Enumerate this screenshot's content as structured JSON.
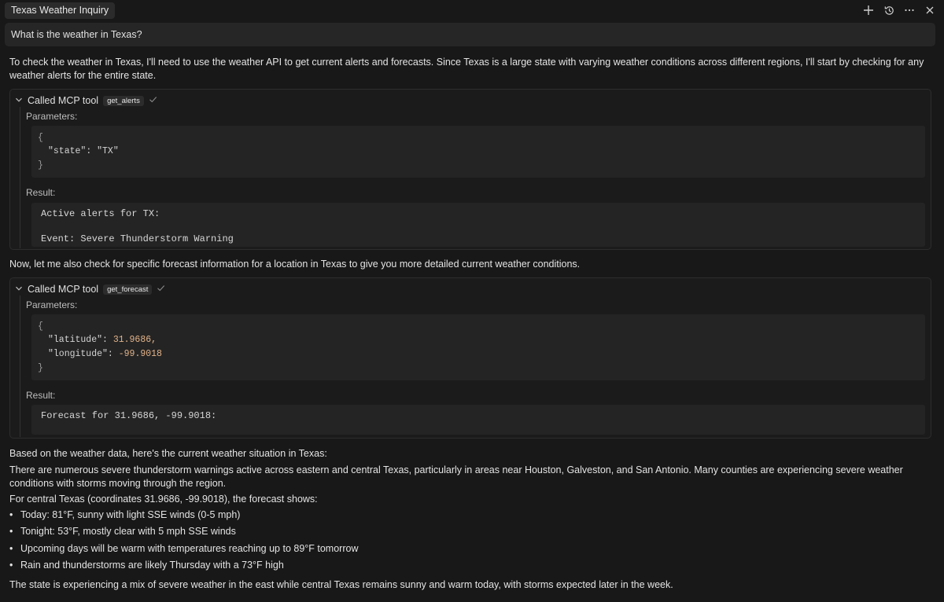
{
  "header": {
    "title": "Texas Weather Inquiry",
    "icons": {
      "new": "plus-icon",
      "history": "history-icon",
      "more": "more-icon",
      "close": "close-icon"
    }
  },
  "prompt": "What is the weather in Texas?",
  "intro": "To check the weather in Texas, I'll need to use the weather API to get current alerts and forecasts. Since Texas is a large state with varying weather conditions across different regions, I'll start by checking for any weather alerts for the entire state.",
  "tool_calls": [
    {
      "header": "Called MCP tool",
      "tool_name": "get_alerts",
      "parameters_label": "Parameters:",
      "params": {
        "open": "{",
        "line1_key": "\"state\"",
        "line1_sep": ": ",
        "line1_val": "\"TX\"",
        "close": "}"
      },
      "result_label": "Result:",
      "result_lines": [
        "Active alerts for TX:",
        "Event: Severe Thunderstorm Warning"
      ]
    },
    {
      "header": "Called MCP tool",
      "tool_name": "get_forecast",
      "parameters_label": "Parameters:",
      "params": {
        "open": "{",
        "line1_key": "\"latitude\"",
        "line1_sep": ": ",
        "line1_val": "31.9686,",
        "line2_key": "\"longitude\"",
        "line2_sep": ": ",
        "line2_val": "-99.9018",
        "close": "}"
      },
      "result_label": "Result:",
      "result_lines": [
        "Forecast for 31.9686, -99.9018:"
      ]
    }
  ],
  "mid_text": "Now, let me also check for specific forecast information for a location in Texas to give you more detailed current weather conditions.",
  "summary_intro": "Based on the weather data, here's the current weather situation in Texas:",
  "summary_para": "There are numerous severe thunderstorm warnings active across eastern and central Texas, particularly in areas near Houston, Galveston, and San Antonio. Many counties are experiencing severe weather conditions with storms moving through the region.",
  "central_intro": "For central Texas (coordinates 31.9686, -99.9018), the forecast shows:",
  "bullets": [
    "Today: 81°F, sunny with light SSE winds (0-5 mph)",
    "Tonight: 53°F, mostly clear with 5 mph SSE winds",
    "Upcoming days will be warm with temperatures reaching up to 89°F tomorrow",
    "Rain and thunderstorms are likely Thursday with a 73°F high"
  ],
  "conclusion": "The state is experiencing a mix of severe weather in the east while central Texas remains sunny and warm today, with storms expected later in the week."
}
